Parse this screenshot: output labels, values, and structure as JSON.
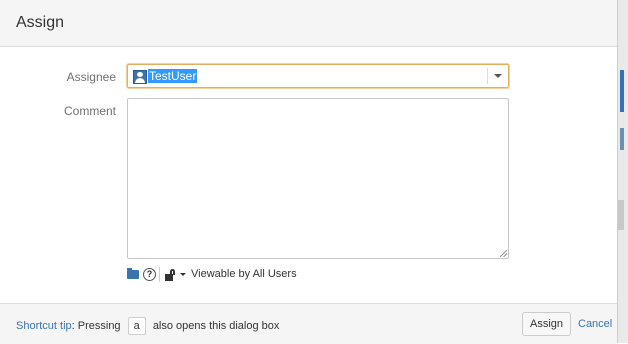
{
  "dialog": {
    "title": "Assign"
  },
  "form": {
    "assignee": {
      "label": "Assignee",
      "value": "TestUser",
      "avatar_icon": "user-avatar-icon"
    },
    "comment": {
      "label": "Comment",
      "value": ""
    }
  },
  "comment_toolbar": {
    "attach_icon": "folder-icon",
    "help_icon": "question-circle-icon",
    "lock_icon": "unlock-icon",
    "visibility_label": "Viewable by All Users"
  },
  "footer": {
    "tip_link": "Shortcut tip",
    "tip_prefix": ": Pressing",
    "tip_key": "a",
    "tip_suffix": "also opens this dialog box",
    "assign_label": "Assign",
    "cancel_label": "Cancel"
  },
  "colors": {
    "accent": "#3b73af",
    "selection": "#3399ff",
    "focus_border": "#e0b060"
  }
}
